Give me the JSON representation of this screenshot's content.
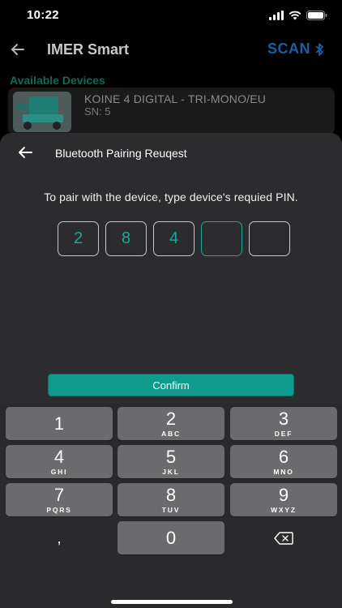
{
  "status_bar": {
    "time": "10:22"
  },
  "app_bar": {
    "title": "IMER Smart",
    "scan_label": "SCAN"
  },
  "devices": {
    "section_label": "Available Devices",
    "items": [
      {
        "name": "KOINE 4 DIGITAL - TRI-MONO/EU",
        "sn": "SN: 5"
      }
    ]
  },
  "dialog": {
    "title": "Bluetooth Pairing Reuqest",
    "instruction": "To pair with the device, type device's requied PIN.",
    "pin_digits": [
      "2",
      "8",
      "4",
      "",
      ""
    ],
    "confirm_label": "Confirm"
  },
  "keypad": {
    "keys": [
      {
        "num": "1",
        "letters": ""
      },
      {
        "num": "2",
        "letters": "ABC"
      },
      {
        "num": "3",
        "letters": "DEF"
      },
      {
        "num": "4",
        "letters": "GHI"
      },
      {
        "num": "5",
        "letters": "JKL"
      },
      {
        "num": "6",
        "letters": "MNO"
      },
      {
        "num": "7",
        "letters": "PQRS"
      },
      {
        "num": "8",
        "letters": "TUV"
      },
      {
        "num": "9",
        "letters": "WXYZ"
      }
    ],
    "comma": ",",
    "zero": "0"
  },
  "colors": {
    "accent": "#0f9b8e",
    "scan_blue": "#1a5fa6",
    "sheet": "#2c2c2e"
  }
}
